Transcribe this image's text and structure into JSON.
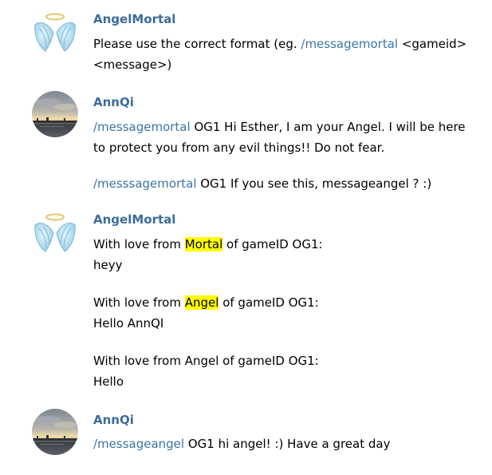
{
  "colors": {
    "sender_name": "#3c6c9a",
    "command_link": "#3d74a4",
    "highlight": "#ffff00",
    "text": "#000000",
    "background": "#ffffff"
  },
  "messages": [
    {
      "sender": "AngelMortal",
      "avatar_icon": "angel-wings-icon",
      "lines": [
        {
          "pre": "Please use the correct format (eg. ",
          "cmd": "/messagemortal",
          "post": " <gameid>"
        },
        {
          "text": "<message>)"
        }
      ]
    },
    {
      "sender": "AnnQi",
      "avatar_icon": "sunset-photo-avatar",
      "lines": [
        {
          "cmd": "/messagemortal",
          "post": " OG1 Hi Esther, I am your Angel. I will be here"
        },
        {
          "text": "to protect you from any evil things!! Do not fear."
        },
        {
          "cmd": "/messsagemortal",
          "post": " OG1 If you see this, messageangel ? :)"
        }
      ]
    },
    {
      "sender": "AngelMortal",
      "avatar_icon": "angel-wings-icon",
      "lines": [
        {
          "pre": "With love from ",
          "hl": "Mortal",
          "post": " of gameID OG1:"
        },
        {
          "text": "heyy"
        },
        {
          "pre": "With love from ",
          "hl": "Angel",
          "post": " of gameID OG1:"
        },
        {
          "text": "Hello AnnQI"
        },
        {
          "text": "With love from Angel of gameID OG1:"
        },
        {
          "text": "Hello"
        }
      ]
    },
    {
      "sender": "AnnQi",
      "avatar_icon": "sunset-photo-avatar",
      "lines": [
        {
          "cmd": "/messageangel",
          "post": " OG1 hi angel! :) Have a great day"
        }
      ]
    }
  ]
}
